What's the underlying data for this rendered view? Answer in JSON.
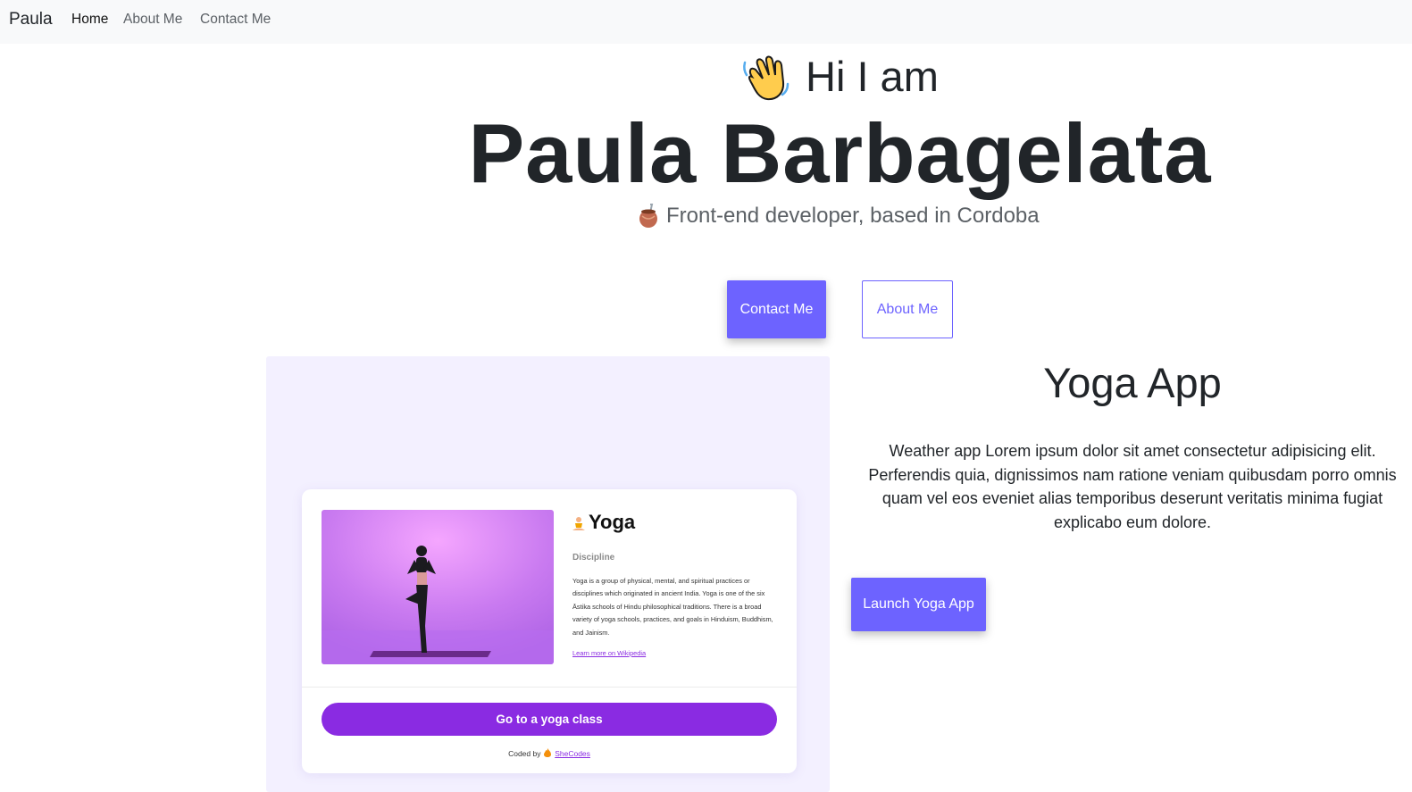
{
  "navbar": {
    "brand": "Paula",
    "links": [
      {
        "label": "Home",
        "active": true
      },
      {
        "label": "About Me",
        "active": false
      },
      {
        "label": "Contact Me",
        "active": false
      }
    ]
  },
  "hero": {
    "greeting": "Hi I am",
    "greeting_icon": "waving-hand-icon",
    "name": "Paula Barbagelata",
    "tagline": "Front-end developer, based in Cordoba",
    "tagline_icon": "mate-cup-icon",
    "contact_button": "Contact Me",
    "about_button": "About Me"
  },
  "project": {
    "title": "Yoga App",
    "description": "Weather app Lorem ipsum dolor sit amet consectetur adipisicing elit. Perferendis quia, dignissimos nam ratione veniam quibusdam porro omnis quam vel eos eveniet alias temporibus deserunt veritatis minima fugiat explicabo eum dolore.",
    "launch_button": "Launch Yoga App",
    "preview": {
      "title": "Yoga",
      "title_icon": "meditation-icon",
      "subtitle": "Discipline",
      "description": "Yoga is a group of physical, mental, and spiritual practices or disciplines which originated in ancient India. Yoga is one of the six Āstika schools of Hindu philosophical traditions. There is a broad variety of yoga schools, practices, and goals in Hinduism, Buddhism, and Jainism.",
      "link": "Learn more on Wikipedia",
      "button": "Go to a yoga class",
      "footer_prefix": "Coded by",
      "footer_icon": "fire-icon",
      "footer_link": "SheCodes"
    }
  },
  "colors": {
    "accent": "#6d63ff",
    "preview_accent": "#8a2be2",
    "navbar_bg": "#f8f9fa",
    "preview_bg": "#f3f0ff"
  }
}
